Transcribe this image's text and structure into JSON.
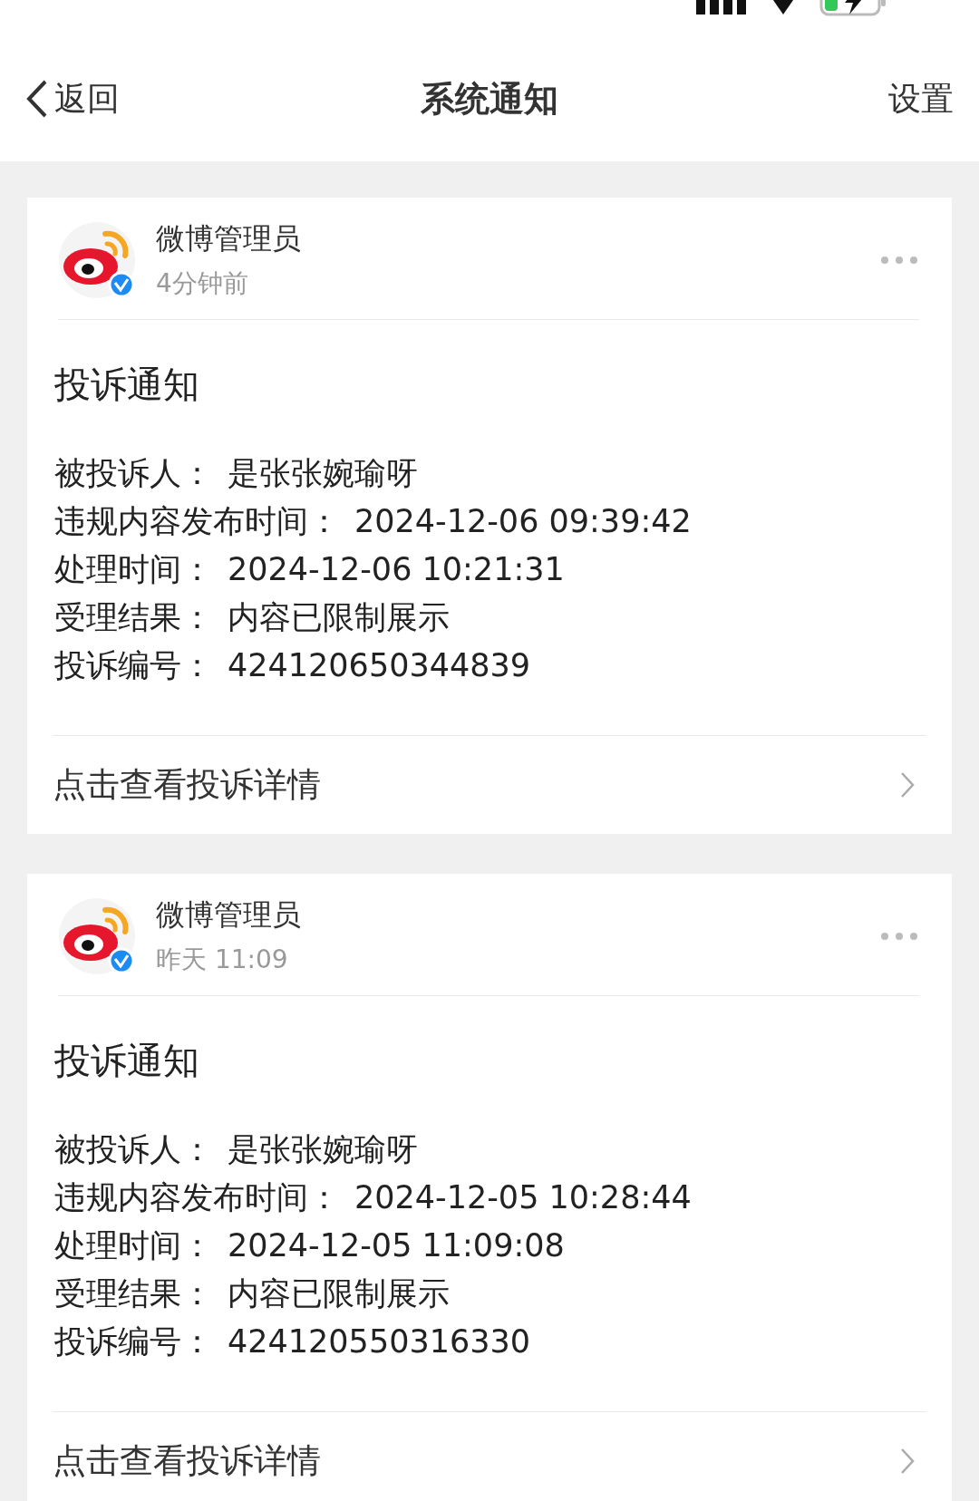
{
  "nav": {
    "back": "返回",
    "title": "系统通知",
    "settings": "设置"
  },
  "notifications": [
    {
      "sender": "微博管理员",
      "time": "4分钟前",
      "title": "投诉通知",
      "fields": [
        {
          "label": "被投诉人：",
          "value": "是张张婉瑜呀"
        },
        {
          "label": "违规内容发布时间：",
          "value": "2024-12-06 09:39:42"
        },
        {
          "label": "处理时间：",
          "value": "2024-12-06 10:21:31"
        },
        {
          "label": "受理结果：",
          "value": "内容已限制展示"
        },
        {
          "label": "投诉编号：",
          "value": "424120650344839"
        }
      ],
      "link": "点击查看投诉详情"
    },
    {
      "sender": "微博管理员",
      "time": "昨天 11:09",
      "title": "投诉通知",
      "fields": [
        {
          "label": "被投诉人：",
          "value": "是张张婉瑜呀"
        },
        {
          "label": "违规内容发布时间：",
          "value": "2024-12-05 10:28:44"
        },
        {
          "label": "处理时间：",
          "value": "2024-12-05 11:09:08"
        },
        {
          "label": "受理结果：",
          "value": "内容已限制展示"
        },
        {
          "label": "投诉编号：",
          "value": "424120550316330"
        }
      ],
      "link": "点击查看投诉详情"
    }
  ]
}
